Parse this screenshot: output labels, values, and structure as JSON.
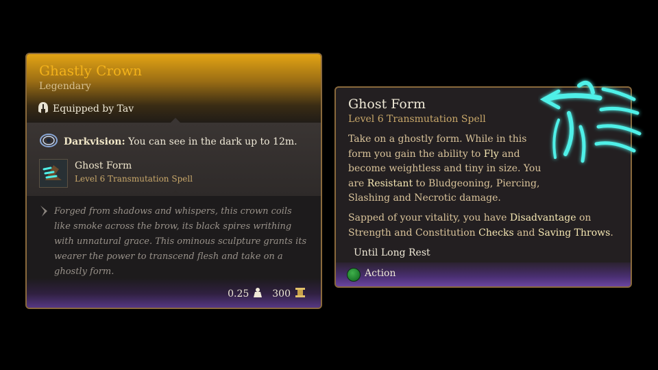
{
  "item": {
    "name": "Ghastly Crown",
    "rarity": "Legendary",
    "equipped_by": "Equipped by Tav",
    "passive_name": "Darkvision:",
    "passive_text": " You can see in the dark up to 12m.",
    "granted_spell_name": "Ghost Form",
    "granted_spell_level": "Level 6 Transmutation Spell",
    "description": "Forged from shadows and whispers, this crown coils like smoke across the brow, its black spires writhing with unnatural grace. This ominous sculpture grants its wearer the power to transcend flesh and take on a ghostly form.",
    "weight": "0.25",
    "value": "300"
  },
  "spell": {
    "title": "Ghost Form",
    "subtitle": "Level 6 Transmutation Spell",
    "desc": {
      "p1_a": "Take on a ghostly form. While in this form you gain the ability to ",
      "p1_fly": "Fly",
      "p1_b": " and become weightless and tiny in size. You are ",
      "p1_resistant": "Resistant",
      "p1_c": " to Bludgeoning, Piercing, Slashing and Necrotic damage.",
      "p2_a": "Sapped of your vitality, you have ",
      "p2_disadvantage": "Disadvantage",
      "p2_b": " on Strength and Constitution ",
      "p2_checks": "Checks",
      "p2_c": " and ",
      "p2_saving": "Saving Throws",
      "p2_d": "."
    },
    "duration": "Until Long Rest",
    "action_label": "Action"
  },
  "colors": {
    "legendary": "#f3b21b",
    "highlight": "#f5e7b3",
    "action": "#2e9a3c"
  },
  "icons": [
    "helmet-icon",
    "darkvision-eye-icon",
    "ghost-form-spell-icon",
    "quill-icon",
    "weight-icon",
    "gold-icon",
    "action-icon"
  ]
}
